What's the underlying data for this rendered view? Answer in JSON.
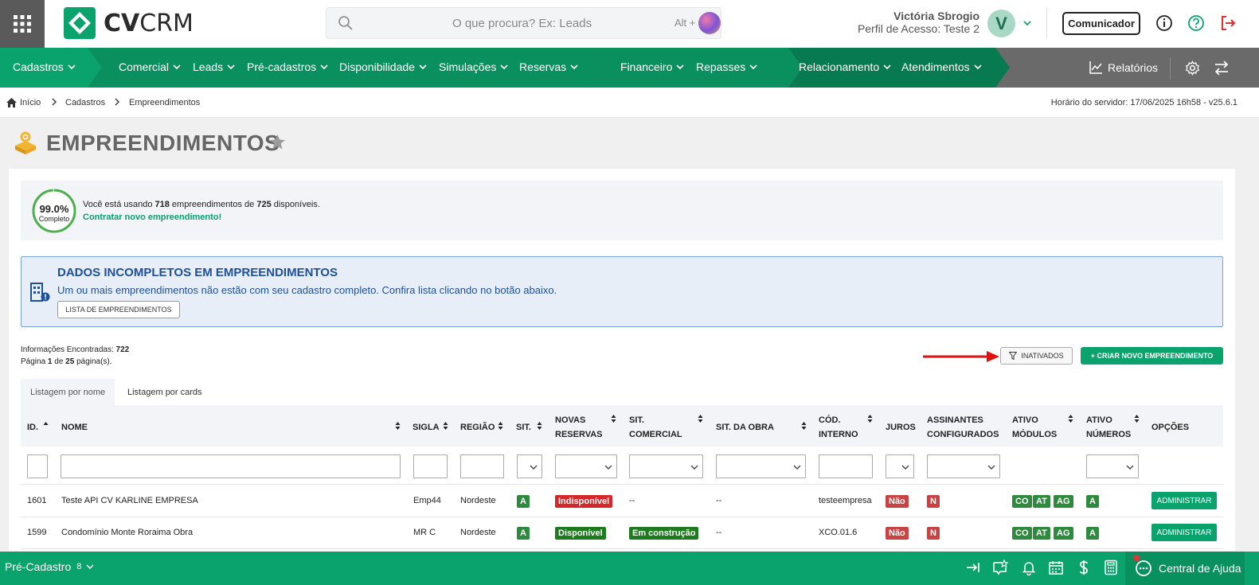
{
  "header": {
    "logo_bold": "CV",
    "logo_light": "CRM",
    "search_placeholder": "O que procura? Ex: Leads",
    "search_hint": "Alt +",
    "user_name": "Victória Sbrogio",
    "user_profile": "Perfil de Acesso: Teste 2",
    "avatar_letter": "V",
    "comunicador_label": "Comunicador"
  },
  "nav": {
    "items": [
      {
        "label": "Cadastros"
      },
      {
        "label": "Comercial"
      },
      {
        "label": "Leads"
      },
      {
        "label": "Pré-cadastros"
      },
      {
        "label": "Disponibilidade"
      },
      {
        "label": "Simulações"
      },
      {
        "label": "Reservas"
      },
      {
        "label": "Financeiro"
      },
      {
        "label": "Repasses"
      },
      {
        "label": "Relacionamento"
      },
      {
        "label": "Atendimentos"
      }
    ],
    "relatorios_label": "Relatórios",
    "colors": {
      "seg1": "#0aa36d",
      "seg2": "#0a8f5f",
      "seg3": "#087a52",
      "rest": "#6a6a6a"
    }
  },
  "breadcrumb": {
    "items": [
      "Início",
      "Cadastros",
      "Empreendimentos"
    ],
    "server_time": "Horário do servidor: 17/06/2025 16h58 - v25.6.1"
  },
  "page": {
    "title": "EMPREENDIMENTOS"
  },
  "usage": {
    "percent_text": "99.0%",
    "percent_value": 0.99,
    "percent_label": "Completo",
    "line_pre": "Você está usando ",
    "used": "718",
    "line_mid": " empreendimentos de ",
    "total": "725",
    "line_post": " disponíveis.",
    "link": "Contratar novo empreendimento!"
  },
  "alert": {
    "title": "DADOS INCOMPLETOS EM EMPREENDIMENTOS",
    "text": "Um ou mais empreendimentos não estão com seu cadastro completo. Confira lista clicando no botão abaixo.",
    "button": "LISTA DE EMPREENDIMENTOS"
  },
  "info": {
    "found_label": "Informações Encontradas: ",
    "found_value": "722",
    "page_label": "Página ",
    "page_current": "1",
    "page_of": " de ",
    "page_total": "25",
    "page_suffix": " página(s)."
  },
  "actions": {
    "inativados": "INATIVADOS",
    "criar": "+ CRIAR NOVO EMPREENDIMENTO"
  },
  "tabs": [
    {
      "label": "Listagem por nome",
      "active": true
    },
    {
      "label": "Listagem por cards",
      "active": false
    }
  ],
  "table": {
    "headers": {
      "id": "ID.",
      "nome": "NOME",
      "sigla": "SIGLA",
      "regiao": "REGIÃO",
      "sit": "SIT.",
      "novas_reservas_1": "NOVAS",
      "novas_reservas_2": "RESERVAS",
      "sit_comercial_1": "SIT.",
      "sit_comercial_2": "COMERCIAL",
      "sit_obra": "SIT. DA OBRA",
      "cod_interno_1": "CÓD.",
      "cod_interno_2": "INTERNO",
      "juros": "JUROS",
      "assinantes_1": "ASSINANTES",
      "assinantes_2": "CONFIGURADOS",
      "modulos_1": "ATIVO",
      "modulos_2": "MÓDULOS",
      "numeros_1": "ATIVO",
      "numeros_2": "NÚMEROS",
      "opcoes": "OPÇÕES"
    },
    "rows": [
      {
        "id": "1601",
        "nome": "Teste API CV KARLINE EMPRESA",
        "sigla": "Emp44",
        "regiao": "Nordeste",
        "sit": "A",
        "novas_reservas": "Indisponível",
        "sit_comercial": "--",
        "sit_obra": "--",
        "cod_interno": "testeempresa",
        "juros": "Não",
        "assinantes": "N",
        "modulos": [
          "CO",
          "AT",
          "AG"
        ],
        "numeros": "A",
        "opcao": "ADMINISTRAR"
      },
      {
        "id": "1599",
        "nome": "Condomínio Monte Roraima Obra",
        "sigla": "MR C",
        "regiao": "Nordeste",
        "sit": "A",
        "novas_reservas": "Disponível",
        "sit_comercial": "Em construção",
        "sit_obra": "--",
        "cod_interno": "XCO.01.6",
        "juros": "Não",
        "assinantes": "N",
        "modulos": [
          "CO",
          "AT",
          "AG"
        ],
        "numeros": "A",
        "opcao": "ADMINISTRAR"
      }
    ]
  },
  "bottombar": {
    "pre_cadastro_label": "Pré-Cadastro",
    "pre_cadastro_count": "8",
    "help_label": "Central de Ajuda"
  }
}
